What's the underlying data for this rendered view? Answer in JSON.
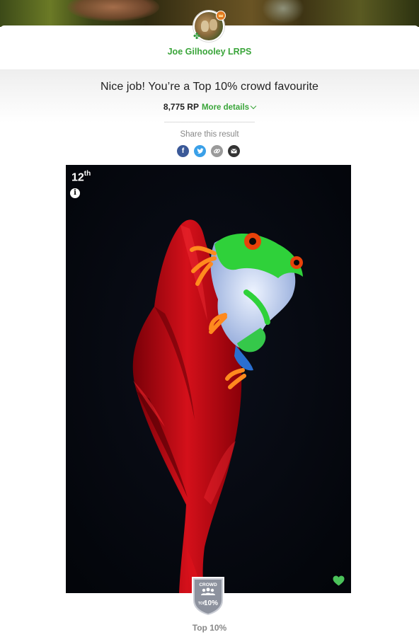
{
  "profile": {
    "name": "Joe Gilhooley LRPS"
  },
  "result": {
    "headline": "Nice job! You’re a Top 10% crowd favourite",
    "rp_value": "8,775 RP",
    "more_details": "More details"
  },
  "share": {
    "label": "Share this result",
    "icons": [
      "facebook-icon",
      "twitter-icon",
      "link-icon",
      "email-icon"
    ],
    "facebook_glyph": "f",
    "colors": {
      "facebook": "#3b5998",
      "twitter": "#3aa0e8",
      "link": "#9a9a9a",
      "email": "#333333"
    }
  },
  "photo": {
    "rank_number": "12",
    "rank_suffix": "th",
    "info_glyph": "i"
  },
  "badge": {
    "top_text": "CROWD",
    "bottom_text_small": "TOP",
    "bottom_text_big": "10%",
    "label": "Top 10%"
  },
  "colors": {
    "accent_green": "#3aa53a",
    "photo_background": "#05070d",
    "heart": "#4bc25a"
  }
}
